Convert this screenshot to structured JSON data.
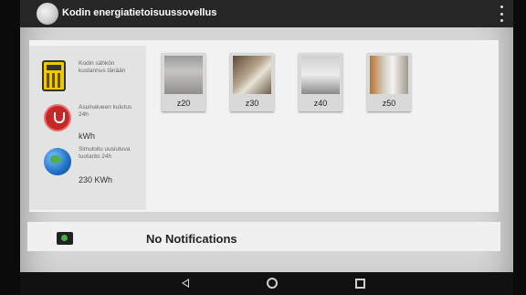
{
  "app": {
    "title": "Kodin energiatietoisuussovellus"
  },
  "left_panel": {
    "cost": {
      "label": "Kodin sähkön kustannus tänään",
      "value": ""
    },
    "area_consumption": {
      "label": "Asuinalueen kulutus 24h",
      "value": "kWh"
    },
    "simulated_production": {
      "label": "Simuloitu uusiutuva tuotanto 24h",
      "value": "230 KWh"
    }
  },
  "devices": [
    {
      "label": "z20"
    },
    {
      "label": "z30"
    },
    {
      "label": "z40"
    },
    {
      "label": "z50"
    }
  ],
  "notifications": {
    "text": "No Notifications"
  },
  "icons": {
    "app": "house-logo-icon",
    "overflow": "overflow-menu-icon",
    "cost": "calculator-icon",
    "consumption": "power-plug-icon",
    "production": "globe-icon",
    "notification": "camera-icon",
    "nav_back": "back-icon",
    "nav_home": "home-icon",
    "nav_recents": "recents-icon"
  },
  "colors": {
    "appbar": "#262626",
    "content_bg": "#f2f2f2",
    "left_panel_bg": "#e3e3e3",
    "cost_icon": "#f0c800",
    "plug_icon": "#c62828"
  }
}
